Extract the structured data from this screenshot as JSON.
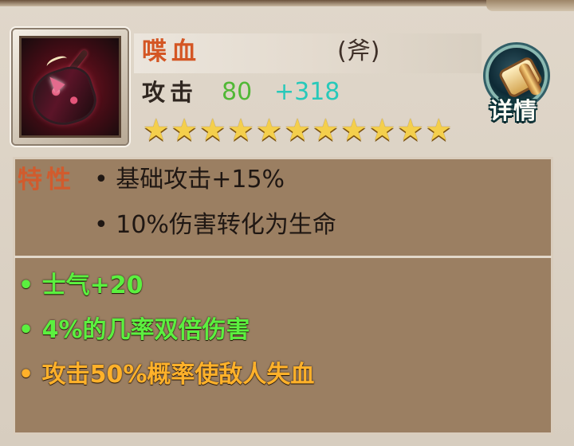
{
  "item": {
    "name": "喋血",
    "type": "(斧)",
    "attack_label": "攻击",
    "attack_base": "80",
    "attack_bonus": "+318",
    "stars": 11,
    "details_label": "详情",
    "icon": "battle-axe-icon",
    "details_icon": "scroll-icon"
  },
  "traits": {
    "label": "特性",
    "items": [
      "• 基础攻击+15%",
      "• 10%伤害转化为生命"
    ]
  },
  "bonuses": [
    "• 士气+20",
    "• 4%的几率双倍伤害",
    "• 攻击50%概率使敌人失血"
  ],
  "colors": {
    "name": "#d45624",
    "attack_base": "#51b836",
    "attack_bonus": "#27c9ba",
    "green_bonus": "#5bf03f",
    "orange_bonus": "#ffb12a",
    "panel": "#9b7f62"
  }
}
